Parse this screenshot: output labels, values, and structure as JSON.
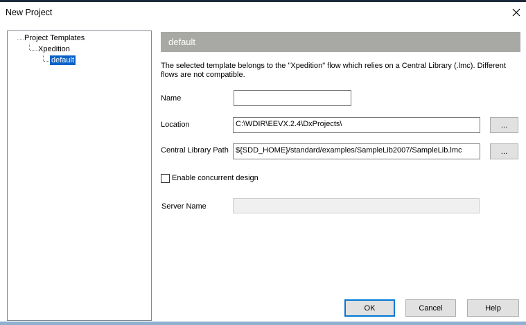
{
  "window": {
    "title": "New Project"
  },
  "tree": {
    "root": "Project Templates",
    "child": "Xpedition",
    "leaf": "default"
  },
  "panel": {
    "header": "default",
    "description_line1": "The selected template belongs to the \"Xpedition\" flow which relies on a Central Library (.lmc). Different",
    "description_line2": "flows are not compatible."
  },
  "form": {
    "name_label": "Name",
    "name_value": "",
    "location_label": "Location",
    "location_value": "C:\\WDIR\\EEVX.2.4\\DxProjects\\",
    "browse_label": "...",
    "library_label": "Central Library Path",
    "library_value": "${SDD_HOME}/standard/examples/SampleLib2007/SampleLib.lmc",
    "concurrent_label": "Enable concurrent design",
    "concurrent_checked": false,
    "server_label": "Server Name",
    "server_value": ""
  },
  "buttons": {
    "ok": "OK",
    "cancel": "Cancel",
    "help": "Help"
  }
}
